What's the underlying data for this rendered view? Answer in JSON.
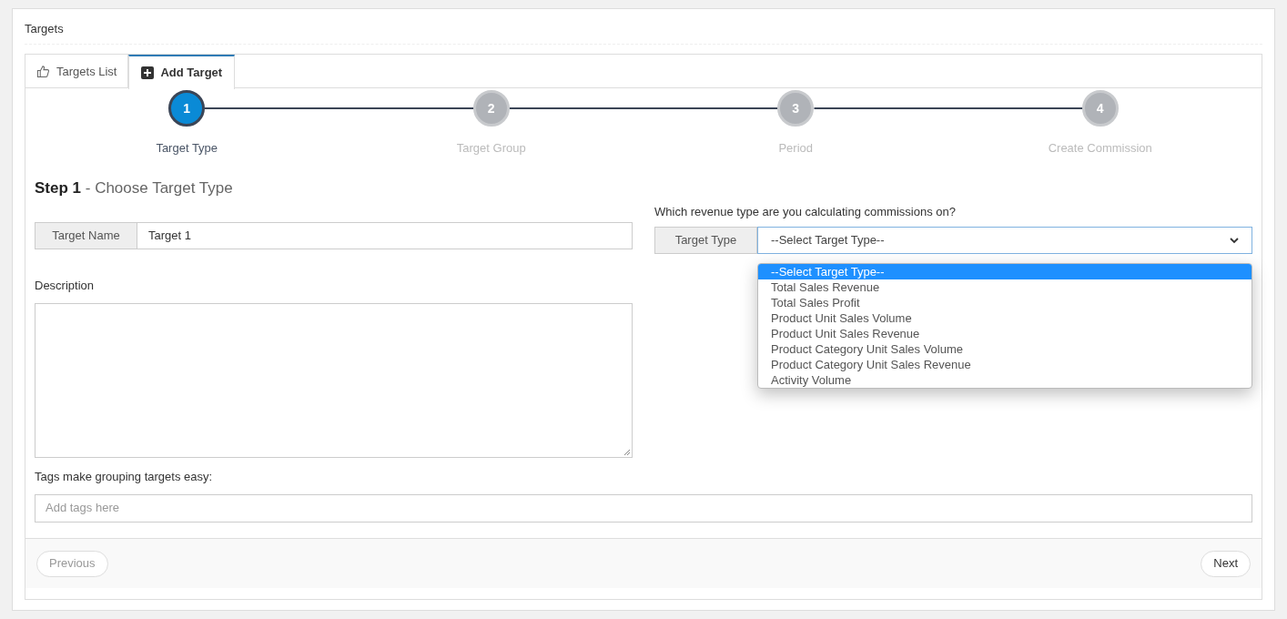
{
  "page_title": "Targets",
  "tabs": [
    {
      "label": "Targets List",
      "selected": false
    },
    {
      "label": "Add Target",
      "selected": true
    }
  ],
  "steps": [
    {
      "number": "1",
      "label": "Target Type",
      "selected": true
    },
    {
      "number": "2",
      "label": "Target Group",
      "selected": false
    },
    {
      "number": "3",
      "label": "Period",
      "selected": false
    },
    {
      "number": "4",
      "label": "Create Commission",
      "selected": false
    }
  ],
  "step_heading": {
    "bold": "Step 1",
    "rest": " - Choose Target Type"
  },
  "target_name": {
    "label": "Target Name",
    "value": "Target 1"
  },
  "target_type": {
    "question": "Which revenue type are you calculating commissions on?",
    "label": "Target Type",
    "value": "--Select Target Type--",
    "expanded": true,
    "options": [
      {
        "label": "--Select Target Type--",
        "selected": true
      },
      {
        "label": "Total Sales Revenue",
        "selected": false
      },
      {
        "label": "Total Sales Profit",
        "selected": false
      },
      {
        "label": "Product Unit Sales Volume",
        "selected": false
      },
      {
        "label": "Product Unit Sales Revenue",
        "selected": false
      },
      {
        "label": "Product Category Unit Sales Volume",
        "selected": false
      },
      {
        "label": "Product Category Unit Sales Revenue",
        "selected": false
      },
      {
        "label": "Activity Volume",
        "selected": false
      }
    ]
  },
  "description": {
    "label": "Description"
  },
  "tags": {
    "label": "Tags make grouping targets easy:",
    "placeholder": "Add tags here"
  },
  "buttons": [
    {
      "label": "Previous",
      "disabled": true
    },
    {
      "label": "Next",
      "disabled": false
    }
  ]
}
